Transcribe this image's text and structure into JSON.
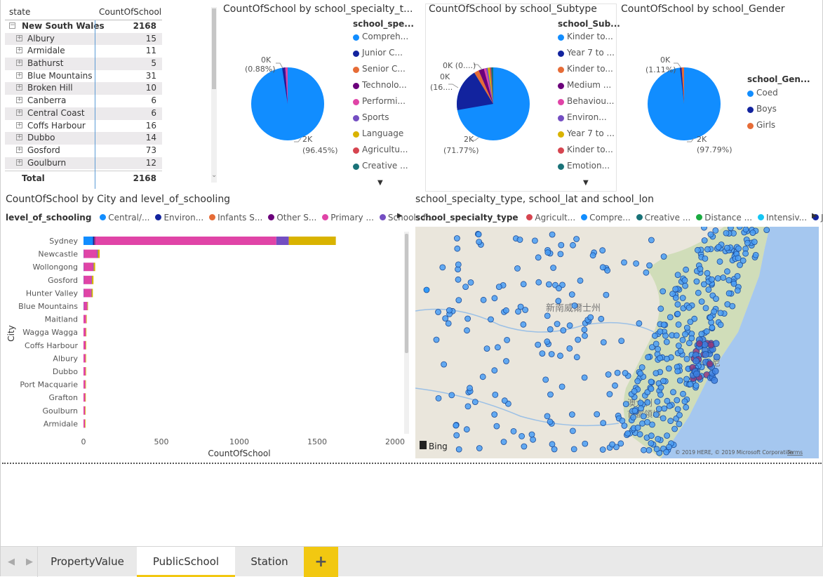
{
  "matrix": {
    "col_state": "state",
    "col_count": "CountOfSchool",
    "group": {
      "label": "New South Wales",
      "value": "2168"
    },
    "rows": [
      {
        "label": "Albury",
        "value": "15"
      },
      {
        "label": "Armidale",
        "value": "11"
      },
      {
        "label": "Bathurst",
        "value": "5"
      },
      {
        "label": "Blue Mountains",
        "value": "31"
      },
      {
        "label": "Broken Hill",
        "value": "10"
      },
      {
        "label": "Canberra",
        "value": "6"
      },
      {
        "label": "Central Coast",
        "value": "6"
      },
      {
        "label": "Coffs Harbour",
        "value": "16"
      },
      {
        "label": "Dubbo",
        "value": "14"
      },
      {
        "label": "Gosford",
        "value": "73"
      },
      {
        "label": "Goulburn",
        "value": "12"
      }
    ],
    "total": {
      "label": "Total",
      "value": "2168"
    }
  },
  "pie1": {
    "title": "CountOfSchool by school_specialty_t...",
    "legend_title": "school_spe...",
    "legend": [
      {
        "label": "Compreh...",
        "color": "#118dff"
      },
      {
        "label": "Junior C...",
        "color": "#12239e"
      },
      {
        "label": "Senior C...",
        "color": "#e66c37"
      },
      {
        "label": "Technolo...",
        "color": "#6b007b"
      },
      {
        "label": "Performi...",
        "color": "#e044a7"
      },
      {
        "label": "Sports",
        "color": "#744ec2"
      },
      {
        "label": "Language",
        "color": "#d9b300"
      },
      {
        "label": "Agricultu...",
        "color": "#d64550"
      },
      {
        "label": "Creative ...",
        "color": "#197278"
      }
    ],
    "label_small_a": "0K",
    "label_small_b": "(0.88%)",
    "label_big_a": "2K",
    "label_big_b": "(96.45%)"
  },
  "pie2": {
    "title": "CountOfSchool by school_Subtype",
    "legend_title": "school_Sub...",
    "legend": [
      {
        "label": "Kinder to...",
        "color": "#118dff"
      },
      {
        "label": "Year 7 to ...",
        "color": "#12239e"
      },
      {
        "label": "Kinder to...",
        "color": "#e66c37"
      },
      {
        "label": "Medium ...",
        "color": "#6b007b"
      },
      {
        "label": "Behaviou...",
        "color": "#e044a7"
      },
      {
        "label": "Environ...",
        "color": "#744ec2"
      },
      {
        "label": "Year 7 to ...",
        "color": "#d9b300"
      },
      {
        "label": "Kinder to...",
        "color": "#d64550"
      },
      {
        "label": "Emotion...",
        "color": "#197278"
      }
    ],
    "label_a1": "0K (0....)",
    "label_b1": "0K",
    "label_b2": "(16....",
    "label_big_a": "2K",
    "label_big_b": "(71.77%)"
  },
  "pie3": {
    "title": "CountOfSchool by school_Gender",
    "legend_title": "school_Gen...",
    "legend": [
      {
        "label": "Coed",
        "color": "#118dff"
      },
      {
        "label": "Boys",
        "color": "#12239e"
      },
      {
        "label": "Girls",
        "color": "#e66c37"
      }
    ],
    "label_small_a": "0K",
    "label_small_b": "(1.11%)",
    "label_big_a": "2K",
    "label_big_b": "(97.79%)"
  },
  "bar": {
    "title": "CountOfSchool by City and level_of_schooling",
    "legend_title": "level_of_schooling",
    "legend": [
      {
        "label": "Central/...",
        "color": "#118dff"
      },
      {
        "label": "Environ...",
        "color": "#12239e"
      },
      {
        "label": "Infants S...",
        "color": "#e66c37"
      },
      {
        "label": "Other S...",
        "color": "#6b007b"
      },
      {
        "label": "Primary ...",
        "color": "#e044a7"
      },
      {
        "label": "Schools f...",
        "color": "#744ec2"
      }
    ]
  },
  "chart_data": {
    "type": "bar",
    "orientation": "horizontal",
    "stacked": true,
    "xlabel": "CountOfSchool",
    "ylabel": "City",
    "xlim": [
      0,
      2000
    ],
    "xticks": [
      "0",
      "500",
      "1000",
      "1500",
      "2000"
    ],
    "categories": [
      "Sydney",
      "Newcastle",
      "Wollongong",
      "Gosford",
      "Hunter Valley",
      "Blue Mountains",
      "Maitland",
      "Wagga Wagga",
      "Coffs Harbour",
      "Albury",
      "Dubbo",
      "Port Macquarie",
      "Grafton",
      "Goulburn",
      "Armidale"
    ],
    "series": [
      {
        "color": "#118dff",
        "values": [
          60,
          1,
          1,
          1,
          1,
          1,
          0,
          0,
          0,
          0,
          0,
          0,
          0,
          0,
          0
        ]
      },
      {
        "color": "#12239e",
        "values": [
          10,
          0,
          0,
          0,
          0,
          0,
          0,
          0,
          0,
          0,
          0,
          0,
          0,
          0,
          0
        ]
      },
      {
        "color": "#e66c37",
        "values": [
          2,
          0,
          0,
          0,
          0,
          0,
          0,
          0,
          0,
          0,
          0,
          0,
          0,
          0,
          0
        ]
      },
      {
        "color": "#6b007b",
        "values": [
          3,
          0,
          0,
          0,
          0,
          0,
          0,
          0,
          0,
          0,
          0,
          0,
          0,
          0,
          0
        ]
      },
      {
        "name": "Primary ...",
        "color": "#e044a7",
        "values": [
          1163,
          85,
          60,
          50,
          48,
          23,
          17,
          15,
          14,
          13,
          13,
          12,
          11,
          10,
          9
        ]
      },
      {
        "name": "Schools f...",
        "color": "#744ec2",
        "values": [
          80,
          6,
          4,
          3,
          3,
          1,
          0,
          0,
          0,
          0,
          0,
          0,
          0,
          0,
          0
        ]
      },
      {
        "color": "#d9b300",
        "values": [
          302,
          12,
          10,
          10,
          8,
          2,
          1,
          1,
          1,
          1,
          1,
          1,
          1,
          1,
          1
        ]
      }
    ]
  },
  "map": {
    "title": "school_specialty_type, school_lat and school_lon",
    "legend_title": "school_specialty_type",
    "legend": [
      {
        "label": "Agricult...",
        "color": "#d64550"
      },
      {
        "label": "Compre...",
        "color": "#118dff"
      },
      {
        "label": "Creative ...",
        "color": "#197278"
      },
      {
        "label": "Distance ...",
        "color": "#1aab40"
      },
      {
        "label": "Intensiv...",
        "color": "#15c6f4"
      },
      {
        "label": "Junior C...",
        "color": "#12239e"
      }
    ],
    "region_label": "新南威爾士州",
    "capital_label_1": "澳大利",
    "capital_label_2": "首都領地",
    "city_label": "尼",
    "bing": "Bing",
    "copyright": "© 2019 HERE, © 2019 Microsoft Corporation",
    "terms": "Terms"
  },
  "tabs": {
    "items": [
      "PropertyValue",
      "PublicSchool",
      "Station"
    ],
    "add": "+"
  }
}
